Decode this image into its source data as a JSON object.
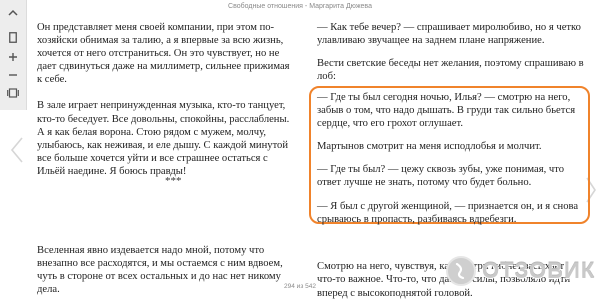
{
  "header": {
    "title": "Свободные отношения - Маргарита Дюжева"
  },
  "toolbar": {
    "icons": [
      "collapse-chevron-icon",
      "page-icon",
      "plus-icon",
      "minus-icon",
      "book-view-icon"
    ]
  },
  "left_page": {
    "paragraphs": [
      "Он представляет меня своей компании, при этом по-хозяйски обнимая за талию, а я впервые за всю жизнь, хочется от него отстраниться. Он это чувствует, но не дает сдвинуться даже на миллиметр, сильнее прижимая к себе.",
      "В зале играет непринужденная музыка, кто-то танцует, кто-то беседует. Все довольны, спокойны, расслаблены. А я как белая ворона. Стою рядом с мужем, молчу, улыбаюсь, как неживая, и еле дышу. С каждой минутой все больше хочется уйти и все страшнее остаться с Ильёй наедине. Я боюсь правды!",
      "Вселенная явно издевается надо мной, потому что внезапно все расходятся, и мы остаемся с ним вдвоем, чуть в стороне от всех остальных и до нас нет никому дела."
    ],
    "separator": "***"
  },
  "right_page": {
    "paragraph_top": "— Как тебе вечер? — спрашивает миролюбиво, но я четко улавливаю звучащее на заднем плане напряжение.",
    "paragraph_top2": "Вести светские беседы нет желания, поэтому спрашиваю в лоб:",
    "highlighted": [
      "— Где ты был сегодня ночью, Илья? — смотрю на него, забыв о том, что надо дышать. В груди так сильно бьется сердце, что его грохот оглушает.",
      "Мартынов смотрит на меня исподлобья и молчит.",
      "— Где ты был? — цежу сквозь зубы, уже понимая, что ответ лучше не знать, потому что будет больно.",
      "— Я был с другой женщиной, — признается он, и я снова срываюсь в пропасть, разбиваясь вдребезги."
    ],
    "paragraph_bottom": "Смотрю на него, чувствуя, как внутри гибнет засыхает что-то важное. Что-то, что давало силы, позволяло идти вперед с высокоподнятой головой."
  },
  "footer": {
    "page_counter": "294 из 542"
  },
  "watermark": {
    "text": "ОТЗОВИК"
  },
  "colors": {
    "highlight": "#f0832b"
  }
}
